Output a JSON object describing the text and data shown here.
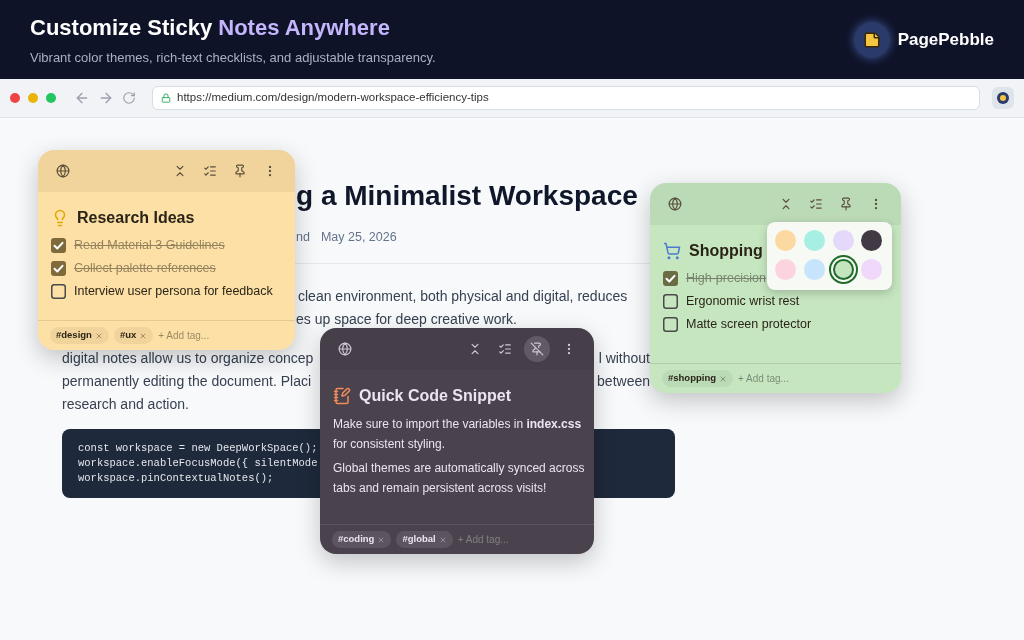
{
  "banner": {
    "title": {
      "lead": "Customize Sticky",
      "accent": "Notes Anywhere"
    },
    "subtitle": "Vibrant color themes, rich-text checklists, and adjustable transparency.",
    "brand": "PagePebble"
  },
  "browser": {
    "url": "https://medium.com/design/modern-workspace-efficiency-tips"
  },
  "article": {
    "heading": "g a Minimalist Workspace",
    "meta": [
      "nd",
      "May 25, 2026"
    ],
    "lines": [
      {
        "right": "clean environment, both physical and digital, reduces"
      },
      {
        "right": "es up space for deep creative work."
      },
      {
        "left": "digital notes allow us to organize concep",
        "right": "l without"
      },
      {
        "left": "permanently editing the document. Placi",
        "right": "between"
      },
      {
        "left": "research and action."
      }
    ],
    "code": [
      "const workspace = new DeepWorkSpace();",
      "workspace.enableFocusMode({ silentMode",
      "workspace.pinContextualNotes();"
    ]
  },
  "notes": [
    {
      "kind": "checklist",
      "color": "#fde0a5",
      "title": "Research Ideas",
      "pinned": false,
      "items": [
        {
          "text": "Read Material 3 Guidelines",
          "checked": true
        },
        {
          "text": "Collect palette references",
          "checked": true
        },
        {
          "text": "Interview user persona for feedback",
          "checked": false
        }
      ],
      "tags": [
        "#design",
        "#ux"
      ],
      "tag_placeholder": "+ Add tag..."
    },
    {
      "kind": "checklist",
      "color": "#c6e6c0",
      "title": "Shopping",
      "pinned": false,
      "items": [
        {
          "text": "High-precision",
          "checked": true
        },
        {
          "text": "Ergonomic wrist rest",
          "checked": false
        },
        {
          "text": "Matte screen protector",
          "checked": false
        }
      ],
      "tags": [
        "#shopping"
      ],
      "tag_placeholder": "+ Add tag...",
      "palette": [
        {
          "color": "#fcd9a0",
          "selected": false
        },
        {
          "color": "#a7efe3",
          "selected": false
        },
        {
          "color": "#e4d9fb",
          "selected": false
        },
        {
          "color": "#413a45",
          "selected": false
        },
        {
          "color": "#fbd4df",
          "selected": false
        },
        {
          "color": "#c6e4fb",
          "selected": false
        },
        {
          "color": "#c4e5bd",
          "selected": true
        },
        {
          "color": "#f0d8fb",
          "selected": false
        }
      ]
    },
    {
      "kind": "text",
      "color": "#4a424d",
      "title": "Quick Code Snippet",
      "pinned": true,
      "body": [
        "Make sure to import the variables in **index.css** for consistent styling.",
        "Global themes are automatically synced across tabs and remain persistent across visits!"
      ],
      "tags": [
        "#coding",
        "#global"
      ],
      "tag_placeholder": "+ Add tag..."
    }
  ]
}
